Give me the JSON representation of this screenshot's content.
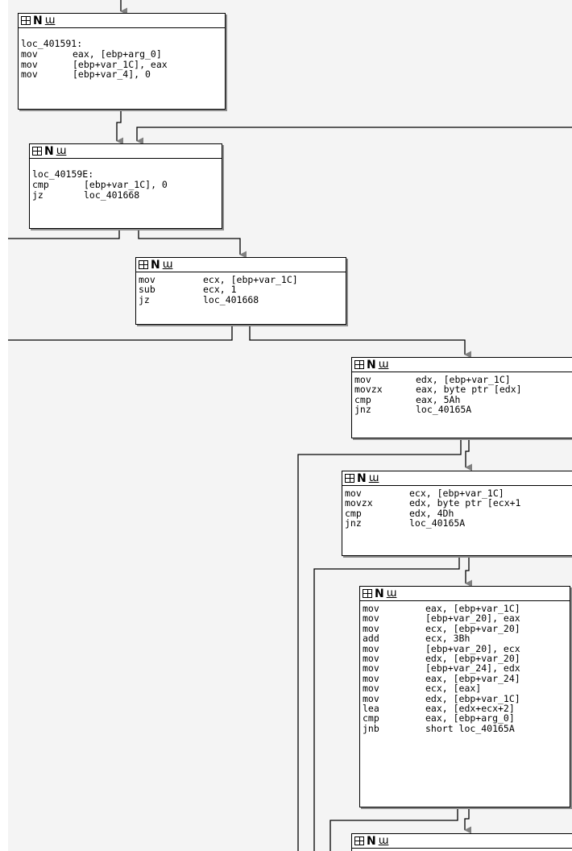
{
  "nodes": [
    {
      "label": "loc_401591:",
      "lines": [
        {
          "mnemonic": "mov",
          "operands": "eax, [ebp+arg_0]"
        },
        {
          "mnemonic": "mov",
          "operands": "[ebp+var_1C], eax"
        },
        {
          "mnemonic": "mov",
          "operands": "[ebp+var_4], 0"
        }
      ]
    },
    {
      "label": "loc_40159E:",
      "lines": [
        {
          "mnemonic": "cmp",
          "operands": "[ebp+var_1C], 0"
        },
        {
          "mnemonic": "jz",
          "operands": "loc_401668"
        }
      ]
    },
    {
      "label": "",
      "lines": [
        {
          "mnemonic": "mov",
          "operands": "ecx, [ebp+var_1C]"
        },
        {
          "mnemonic": "sub",
          "operands": "ecx, 1"
        },
        {
          "mnemonic": "jz",
          "operands": "loc_401668"
        }
      ]
    },
    {
      "label": "",
      "lines": [
        {
          "mnemonic": "mov",
          "operands": "edx, [ebp+var_1C]"
        },
        {
          "mnemonic": "movzx",
          "operands": "eax, byte ptr [edx]"
        },
        {
          "mnemonic": "cmp",
          "operands": "eax, 5Ah"
        },
        {
          "mnemonic": "jnz",
          "operands": "loc_40165A"
        }
      ]
    },
    {
      "label": "",
      "lines": [
        {
          "mnemonic": "mov",
          "operands": "ecx, [ebp+var_1C]"
        },
        {
          "mnemonic": "movzx",
          "operands": "edx, byte ptr [ecx+1"
        },
        {
          "mnemonic": "cmp",
          "operands": "edx, 4Dh"
        },
        {
          "mnemonic": "jnz",
          "operands": "loc_40165A"
        }
      ]
    },
    {
      "label": "",
      "lines": [
        {
          "mnemonic": "mov",
          "operands": "eax, [ebp+var_1C]"
        },
        {
          "mnemonic": "mov",
          "operands": "[ebp+var_20], eax"
        },
        {
          "mnemonic": "mov",
          "operands": "ecx, [ebp+var_20]"
        },
        {
          "mnemonic": "add",
          "operands": "ecx, 3Bh"
        },
        {
          "mnemonic": "mov",
          "operands": "[ebp+var_20], ecx"
        },
        {
          "mnemonic": "mov",
          "operands": "edx, [ebp+var_20]"
        },
        {
          "mnemonic": "mov",
          "operands": "[ebp+var_24], edx"
        },
        {
          "mnemonic": "mov",
          "operands": "eax, [ebp+var_24]"
        },
        {
          "mnemonic": "mov",
          "operands": "ecx, [eax]"
        },
        {
          "mnemonic": "mov",
          "operands": "edx, [ebp+var_1C]"
        },
        {
          "mnemonic": "lea",
          "operands": "eax, [edx+ecx+2]"
        },
        {
          "mnemonic": "cmp",
          "operands": "eax, [ebp+arg_0]"
        },
        {
          "mnemonic": "jnb",
          "operands": "short loc_40165A"
        }
      ]
    },
    {
      "label": "",
      "lines": []
    }
  ],
  "header_icons": [
    "graph-grid-icon",
    "n-letter-icon",
    "uw-comment-icon"
  ],
  "header_n_glyph": "N",
  "header_uw_glyph": "ɯ",
  "colors": {
    "background": "#f4f4f4",
    "node_fill": "#ffffff",
    "edge": "#000000",
    "arrow": "#808080",
    "shadow": "#8c8c8c"
  }
}
